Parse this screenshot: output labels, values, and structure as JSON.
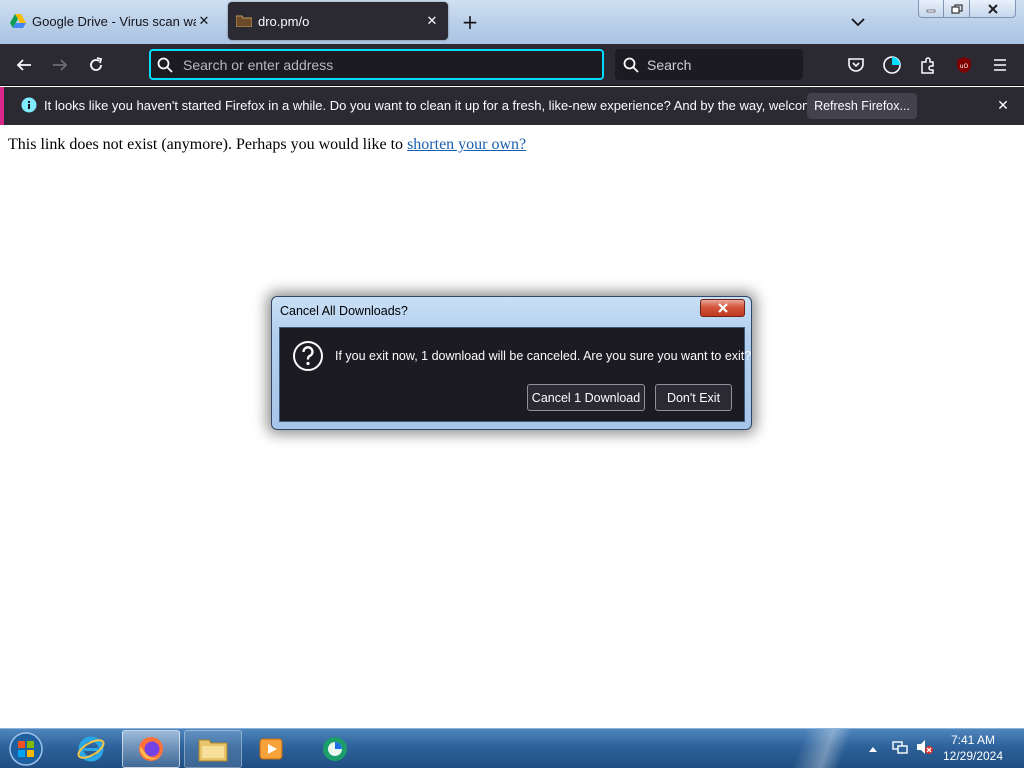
{
  "browser": {
    "tabs": [
      {
        "title": "Google Drive - Virus scan warni",
        "active": false,
        "favicon": "google-drive-icon"
      },
      {
        "title": "dro.pm/o",
        "active": true,
        "favicon": "folder-favicon-icon"
      }
    ],
    "urlbar_placeholder": "Search or enter address",
    "searchbar_placeholder": "Search"
  },
  "notification": {
    "message": "It looks like you haven't started Firefox in a while. Do you want to clean it up for a fresh, like-new experience? And by the way, welcome back!",
    "button_label": "Refresh Firefox...",
    "accent_color": "#d9278a"
  },
  "page": {
    "text": "This link does not exist (anymore). Perhaps you would like to ",
    "link_text": "shorten your own?"
  },
  "dialog": {
    "title": "Cancel All Downloads?",
    "message": "If you exit now, 1 download will be canceled. Are you sure you want to exit?",
    "confirm_label": "Cancel 1 Download",
    "cancel_label": "Don't Exit"
  },
  "taskbar": {
    "items": [
      "internet-explorer-icon",
      "firefox-icon",
      "file-explorer-icon",
      "media-player-icon",
      "app-icon"
    ],
    "time": "7:41 AM",
    "date": "12/29/2024"
  }
}
